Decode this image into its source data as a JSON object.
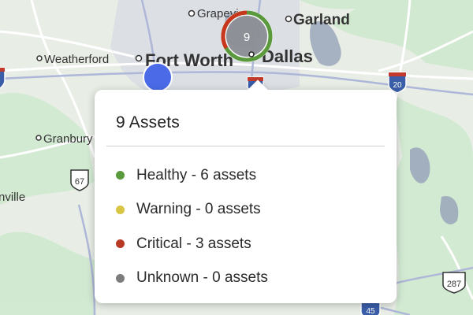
{
  "map": {
    "labels": {
      "grapevine": "Grapevin",
      "garland": "Garland",
      "weatherford": "Weatherford",
      "fort_worth": "Fort Worth",
      "dallas": "Dallas",
      "granbury": "Granbury",
      "ville": "nville"
    },
    "shields": {
      "i20": "20",
      "us67": "67",
      "us287": "287",
      "i45": "45"
    },
    "cluster": {
      "count": "9",
      "healthy_fraction": 0.6667,
      "critical_fraction": 0.3333
    }
  },
  "popup": {
    "title": "9 Assets",
    "statuses": [
      {
        "label": "Healthy - 6 assets",
        "color": "#5a9a3c"
      },
      {
        "label": "Warning - 0 assets",
        "color": "#d9c544"
      },
      {
        "label": "Critical - 3 assets",
        "color": "#b83a25"
      },
      {
        "label": "Unknown - 0 assets",
        "color": "#7d7d7d"
      }
    ]
  },
  "colors": {
    "location_marker": "#4a6ae8",
    "cluster_healthy": "#5a9a3c",
    "cluster_critical": "#c8361d"
  }
}
